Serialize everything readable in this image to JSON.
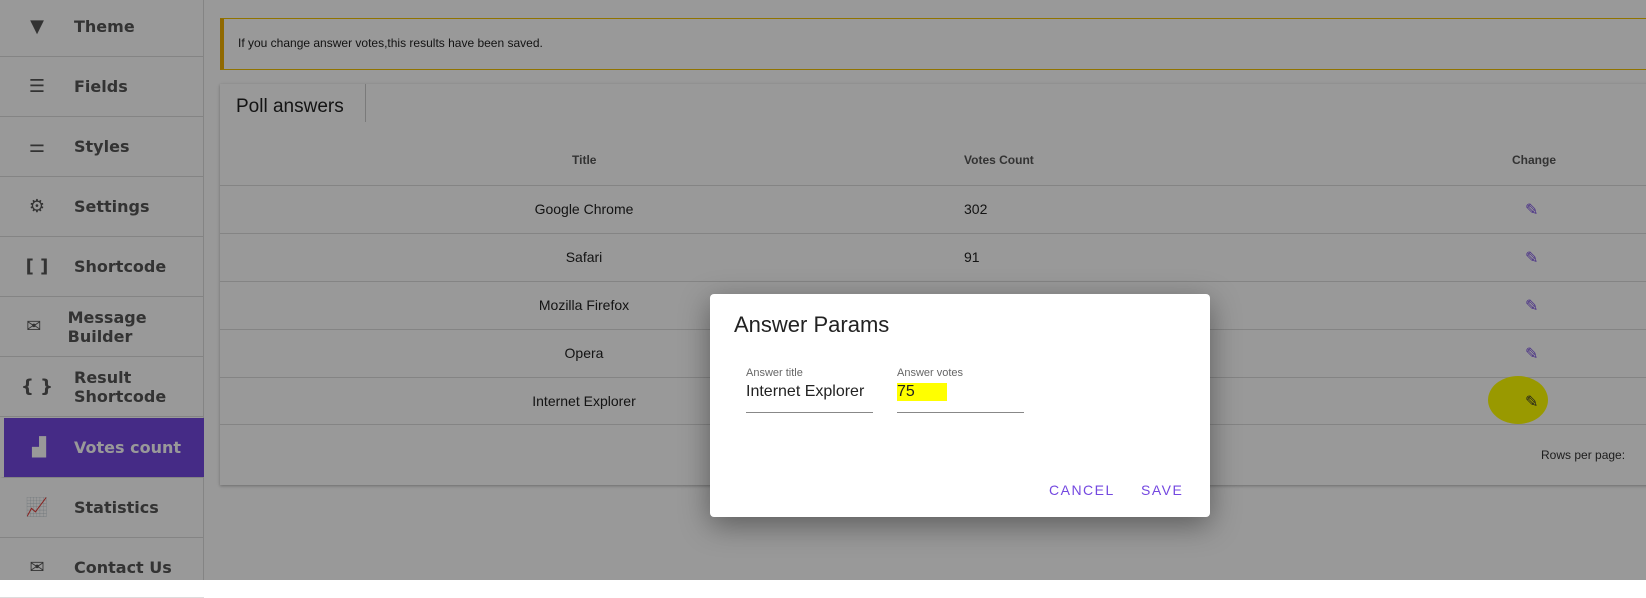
{
  "sidebar": {
    "items": [
      {
        "label": "Theme",
        "icon": "paint-roller-icon"
      },
      {
        "label": "Fields",
        "icon": "list-icon"
      },
      {
        "label": "Styles",
        "icon": "sliders-icon"
      },
      {
        "label": "Settings",
        "icon": "gears-icon"
      },
      {
        "label": "Shortcode",
        "icon": "brackets-icon"
      },
      {
        "label": "Message Builder",
        "icon": "envelope-heart-icon"
      },
      {
        "label": "Result Shortcode",
        "icon": "braces-icon"
      },
      {
        "label": "Votes count",
        "icon": "podium-icon",
        "active": true
      },
      {
        "label": "Statistics",
        "icon": "chart-icon"
      },
      {
        "label": "Contact Us",
        "icon": "envelope-at-icon"
      }
    ]
  },
  "notice": "If you change answer votes,this results have been saved.",
  "card": {
    "title": "Poll answers",
    "columns": [
      "Title",
      "Votes Count",
      "Change"
    ],
    "rows": [
      {
        "title": "Google Chrome",
        "votes": "302"
      },
      {
        "title": "Safari",
        "votes": "91"
      },
      {
        "title": "Mozilla Firefox",
        "votes": ""
      },
      {
        "title": "Opera",
        "votes": ""
      },
      {
        "title": "Internet Explorer",
        "votes": ""
      }
    ],
    "rows_per_page": "Rows per page:"
  },
  "dialog": {
    "title": "Answer Params",
    "title_label": "Answer title",
    "title_value": "Internet Explorer",
    "votes_label": "Answer votes",
    "votes_value": "75",
    "cancel": "CANCEL",
    "save": "SAVE"
  },
  "colors": {
    "accent": "#7448e0",
    "highlight": "#ffff00",
    "notice_border": "#f0b000"
  }
}
